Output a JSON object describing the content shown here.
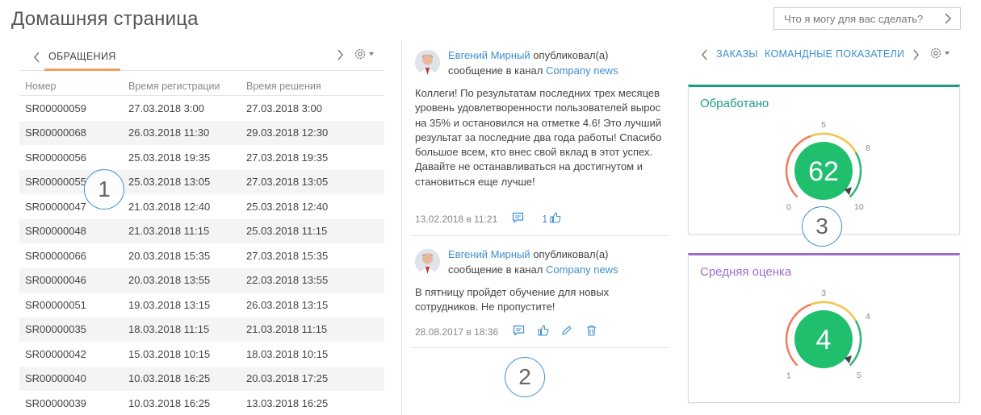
{
  "page": {
    "title": "Домашняя страница"
  },
  "assistant": {
    "placeholder": "Что я могу для вас сделать?"
  },
  "left": {
    "tab_label": "ОБРАЩЕНИЯ",
    "columns": [
      "Номер",
      "Время регистрации",
      "Время решения"
    ],
    "rows": [
      [
        "SR00000059",
        "27.03.2018 3:00",
        "27.03.2018 3:00"
      ],
      [
        "SR00000068",
        "26.03.2018 11:30",
        "29.03.2018 12:30"
      ],
      [
        "SR00000056",
        "25.03.2018 19:35",
        "27.03.2018 19:35"
      ],
      [
        "SR00000055",
        "25.03.2018 13:05",
        "27.03.2018 13:05"
      ],
      [
        "SR00000047",
        "21.03.2018 12:40",
        "25.03.2018 12:40"
      ],
      [
        "SR00000048",
        "21.03.2018 11:15",
        "25.03.2018 11:15"
      ],
      [
        "SR00000066",
        "20.03.2018 15:35",
        "27.03.2018 15:35"
      ],
      [
        "SR00000046",
        "20.03.2018 13:55",
        "22.03.2018 13:55"
      ],
      [
        "SR00000051",
        "19.03.2018 13:15",
        "26.03.2018 13:15"
      ],
      [
        "SR00000035",
        "18.03.2018 11:15",
        "21.03.2018 11:15"
      ],
      [
        "SR00000042",
        "15.03.2018 10:15",
        "18.03.2018 10:15"
      ],
      [
        "SR00000040",
        "10.03.2018 16:25",
        "20.03.2018 17:25"
      ],
      [
        "SR00000039",
        "10.03.2018 16:25",
        "13.03.2018 16:25"
      ]
    ]
  },
  "feed": {
    "posts": [
      {
        "author": "Евгений Мирный",
        "action": "опубликовал(а) сообщение в канал",
        "channel": "Company news",
        "text": "Коллеги! По результатам последних трех месяцев уровень удовлетворенности пользователей вырос на 35% и остановился на отметке 4.6! Это лучший результат за последние два года работы! Спасибо большое всем, кто внес свой вклад в этот успех. Давайте не останавливаться на достигнутом и становиться еще лучше!",
        "date": "13.02.2018 в 11:21",
        "likes": "1"
      },
      {
        "author": "Евгений Мирный",
        "action": "опубликовал(а) сообщение в канал",
        "channel": "Company news",
        "text": "В пятницу пройдет обучение для новых сотрудников. Не пропустите!",
        "date": "28.08.2017 в 18:36"
      }
    ]
  },
  "right": {
    "tabs": [
      "ЗАКАЗЫ",
      "КОМАНДНЫЕ ПОКАЗАТЕЛИ"
    ],
    "cards": [
      {
        "title": "Обработано",
        "accent": "#1a9e7f",
        "value": 62,
        "min": "0",
        "max": "10",
        "mid": "5",
        "upper": "8",
        "value_color": "#1fbf6e"
      },
      {
        "title": "Средняя оценка",
        "accent": "#9b6fc9",
        "value": 4,
        "min": "1",
        "max": "5",
        "mid": "3",
        "upper": "4",
        "value_color": "#1fbf6e"
      }
    ]
  },
  "markers": [
    "1",
    "2",
    "3"
  ],
  "colors": {
    "link": "#3d8fd1",
    "tab_accent": "#f3a15a"
  },
  "icons": [
    "chevron-right-icon",
    "chevron-left-icon",
    "gear-icon",
    "comment-icon",
    "like-icon",
    "edit-icon",
    "trash-icon"
  ]
}
